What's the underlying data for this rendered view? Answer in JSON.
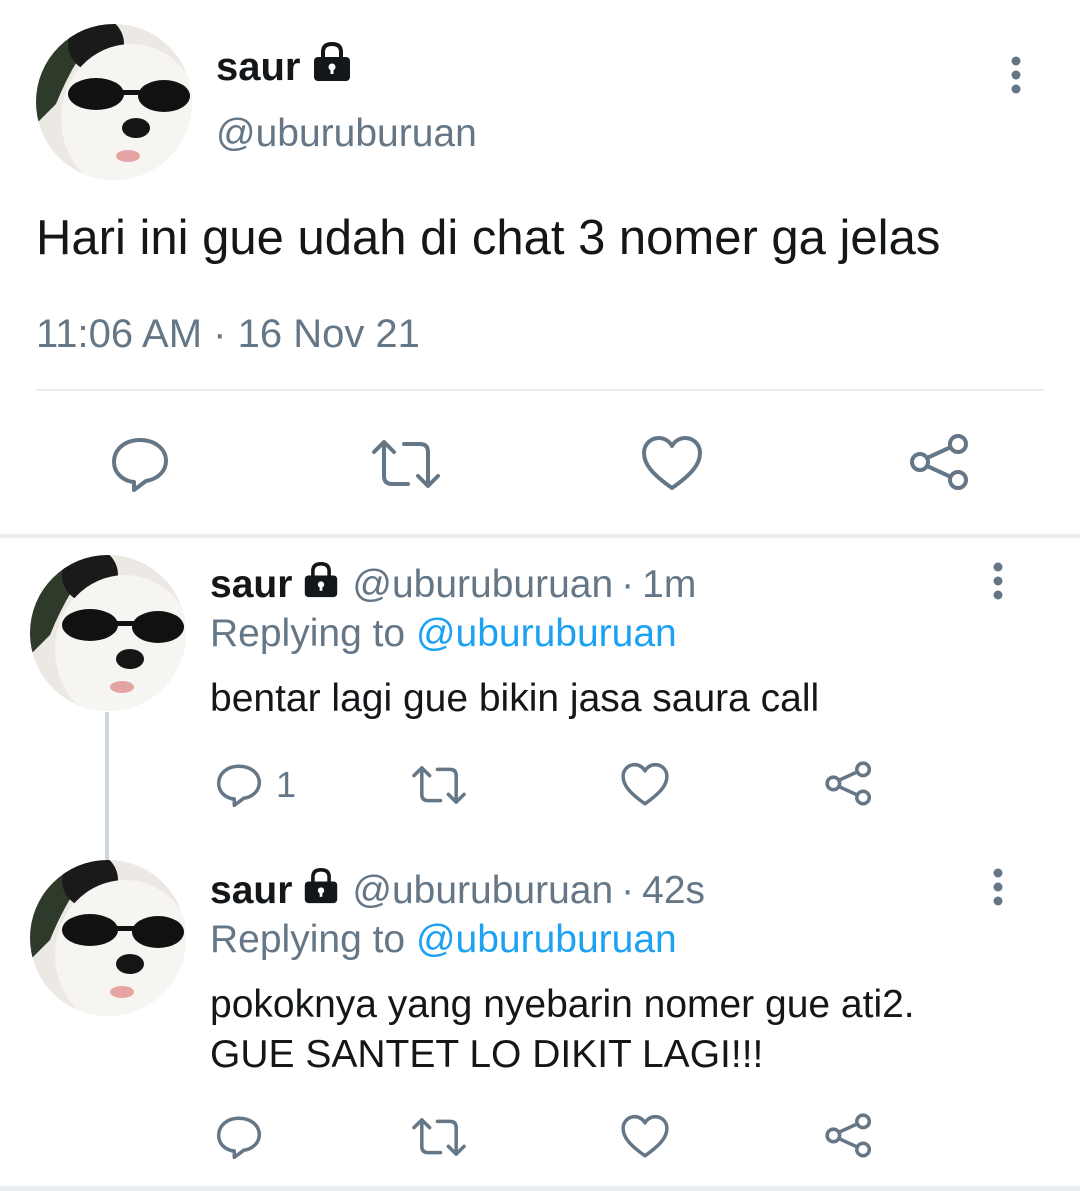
{
  "main_tweet": {
    "display_name": "saur",
    "handle": "@uburuburuan",
    "text": "Hari ini gue udah di chat 3 nomer ga jelas",
    "timestamp": "11:06 AM · 16 Nov 21",
    "locked": true
  },
  "replies": [
    {
      "display_name": "saur",
      "handle": "@uburuburuan",
      "dot": "·",
      "time": "1m",
      "replying_prefix": "Replying to ",
      "replying_to": "@uburuburuan",
      "text_lines": [
        "bentar lagi gue bikin jasa saura call"
      ],
      "reply_count": "1"
    },
    {
      "display_name": "saur",
      "handle": "@uburuburuan",
      "dot": "·",
      "time": "42s",
      "replying_prefix": "Replying to ",
      "replying_to": "@uburuburuan",
      "text_lines": [
        "pokoknya yang nyebarin nomer gue ati2.",
        "GUE SANTET LO DIKIT LAGI!!!"
      ],
      "reply_count": ""
    }
  ],
  "colors": {
    "primary_text": "#14171a",
    "secondary_text": "#657786",
    "link": "#1da1f2",
    "divider": "#e6ecf0"
  },
  "icons": [
    "lock-icon",
    "more-icon",
    "reply-icon",
    "retweet-icon",
    "like-icon",
    "share-icon",
    "avatar-image"
  ]
}
